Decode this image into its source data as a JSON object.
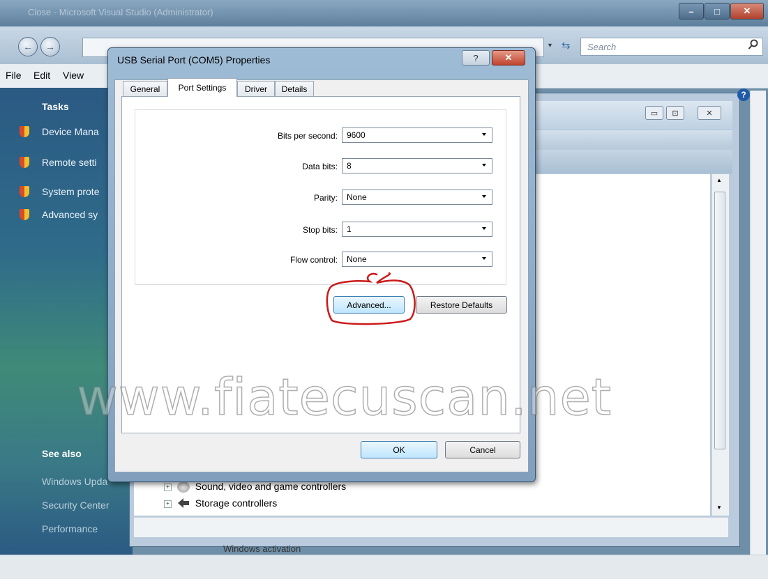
{
  "outer_window": {
    "title": "Close - Microsoft Visual Studio (Administrator)",
    "controls": {
      "minimize": "–",
      "maximize": "□",
      "close": "✕"
    },
    "nav": {
      "back": "←",
      "forward": "→",
      "dropdown": "▾",
      "refresh": "⇆"
    },
    "search": {
      "placeholder": "Search",
      "icon": "search-icon"
    }
  },
  "menu": [
    "File",
    "Edit",
    "View"
  ],
  "tasks_pane": {
    "heading": "Tasks",
    "items": [
      "Device Mana",
      "Remote setti",
      "System prote",
      "Advanced sy"
    ],
    "see_also_heading": "See also",
    "see_also": [
      "Windows Upda",
      "Security Center",
      "Performance"
    ]
  },
  "device_manager": {
    "tree": [
      {
        "label": "Sound, video and game controllers",
        "icon": "speaker-icon"
      },
      {
        "label": "Storage controllers",
        "icon": "storage-icon"
      }
    ],
    "footer_text": "Windows activation",
    "help_icon": "?"
  },
  "dialog": {
    "title": "USB Serial Port (COM5) Properties",
    "help_btn": "?",
    "close_btn": "✕",
    "tabs": [
      {
        "label": "General",
        "active": false
      },
      {
        "label": "Port Settings",
        "active": true
      },
      {
        "label": "Driver",
        "active": false
      },
      {
        "label": "Details",
        "active": false
      }
    ],
    "fields": [
      {
        "label": "Bits per second:",
        "value": "9600"
      },
      {
        "label": "Data bits:",
        "value": "8"
      },
      {
        "label": "Parity:",
        "value": "None"
      },
      {
        "label": "Stop bits:",
        "value": "1"
      },
      {
        "label": "Flow control:",
        "value": "None"
      }
    ],
    "advanced_btn": "Advanced...",
    "restore_btn": "Restore Defaults",
    "ok_btn": "OK",
    "cancel_btn": "Cancel"
  },
  "watermark": "www.fiatecuscan.net",
  "colors": {
    "annotation": "#cc1a1a",
    "accent": "#3c7fb1"
  }
}
